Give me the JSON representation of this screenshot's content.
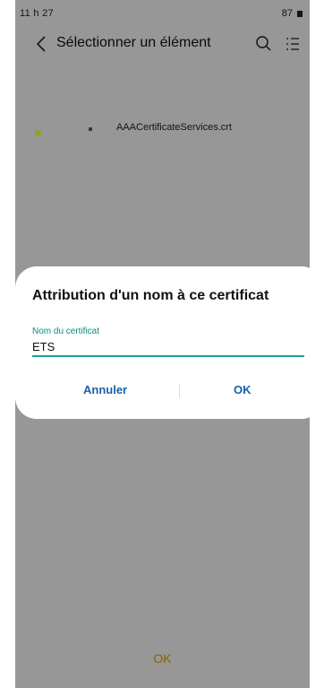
{
  "status_bar": {
    "time": "11 h 27",
    "battery": "87"
  },
  "app_bar": {
    "title": "Sélectionner un élément"
  },
  "file_list": {
    "items": [
      {
        "name": "AAACertificateServices.crt"
      }
    ]
  },
  "bottom": {
    "ok_label": "OK"
  },
  "dialog": {
    "title": "Attribution d'un nom à ce certificat",
    "field_label": "Nom du certificat",
    "field_value": "ETS",
    "cancel_label": "Annuler",
    "ok_label": "OK"
  },
  "colors": {
    "accent": "#17a39e",
    "button": "#1b5fa8",
    "bottom_ok": "#d9a200"
  },
  "icons": {
    "back": "chevron-left",
    "search": "magnifier",
    "more": "list-menu"
  }
}
